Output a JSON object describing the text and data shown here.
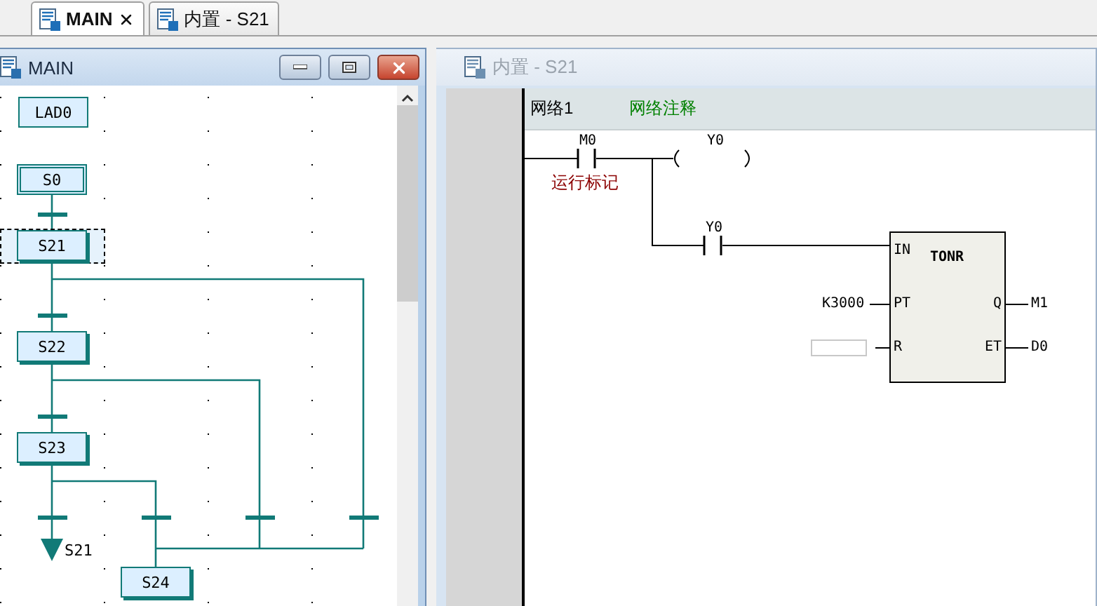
{
  "tabs": [
    {
      "label": "MAIN",
      "selected": true,
      "closable": true
    },
    {
      "label": "内置 - S21",
      "selected": false,
      "closable": false
    }
  ],
  "sfc_window": {
    "title": "MAIN",
    "active": true,
    "steps": [
      {
        "label": "LAD0",
        "kind": "ladder",
        "selected": false
      },
      {
        "label": "S0",
        "kind": "initial",
        "selected": false
      },
      {
        "label": "S21",
        "kind": "step",
        "selected": true
      },
      {
        "label": "S22",
        "kind": "step",
        "selected": false
      },
      {
        "label": "S23",
        "kind": "step",
        "selected": false
      },
      {
        "label": "S24",
        "kind": "step",
        "selected": false
      }
    ],
    "jump": {
      "label": "S21"
    }
  },
  "ladder_window": {
    "title": "内置 - S21",
    "active": false,
    "network": {
      "label": "网络1",
      "comment": "网络注释"
    },
    "contact_1": {
      "operand": "M0",
      "comment": "运行标记"
    },
    "coil": {
      "operand": "Y0"
    },
    "contact_2": {
      "operand": "Y0"
    },
    "timer": {
      "name": "TONR",
      "inputs": [
        {
          "pin": "IN",
          "kind": "wire"
        },
        {
          "pin": "PT",
          "kind": "operand",
          "operand": "K3000"
        },
        {
          "pin": "R",
          "kind": "blank"
        }
      ],
      "outputs": [
        {
          "pin": "Q",
          "operand": "M1"
        },
        {
          "pin": "ET",
          "operand": "D0"
        }
      ]
    }
  }
}
